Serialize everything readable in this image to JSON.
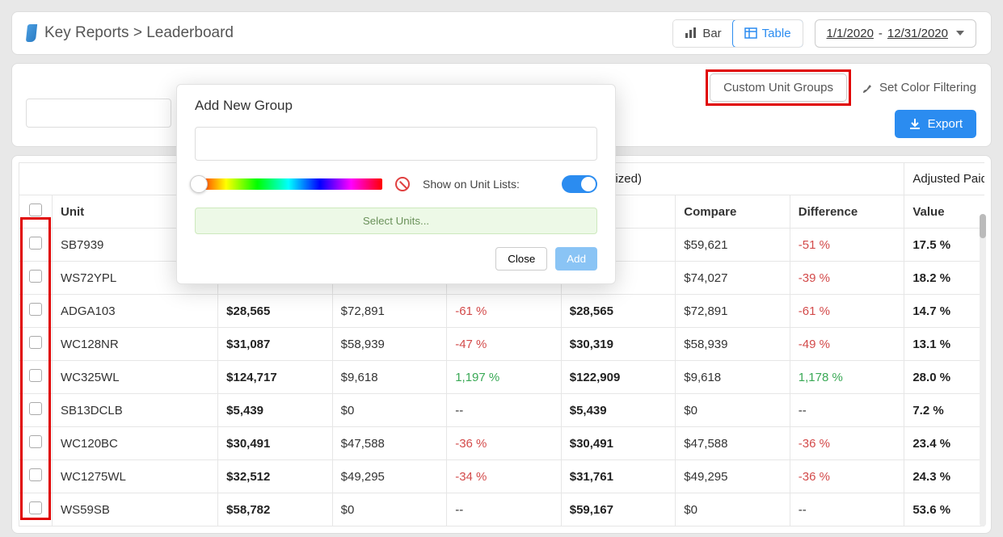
{
  "breadcrumb": {
    "section": "Key Reports",
    "page": "Leaderboard",
    "separator": ">"
  },
  "viewToggle": {
    "bar": "Bar",
    "table": "Table"
  },
  "dateRange": {
    "start": "1/1/2020",
    "sep": "-",
    "end": "12/31/2020"
  },
  "toolbar": {
    "custom_unit_groups": "Custom Unit Groups",
    "set_color_filtering": "Set Color Filtering",
    "export": "Export"
  },
  "modal": {
    "title": "Add New Group",
    "show_on_lists": "Show on Unit Lists:",
    "select_units": "Select Units...",
    "close": "Close",
    "add": "Add"
  },
  "tableHead": {
    "group1": "(Recognized)",
    "group2": "Adjusted Paid Occ",
    "unit": "Unit",
    "compare": "Compare",
    "difference": "Difference",
    "value": "Value"
  },
  "rows": [
    {
      "unit": "SB7939",
      "v1": "",
      "c1": "",
      "d1": "",
      "v2": "",
      "c2": "$59,621",
      "d2": "-51 %",
      "p": "17.5 %"
    },
    {
      "unit": "WS72YPL",
      "v1": "",
      "c1": "",
      "d1": "",
      "v2": "",
      "c2": "$74,027",
      "d2": "-39 %",
      "p": "18.2 %"
    },
    {
      "unit": "ADGA103",
      "v1": "$28,565",
      "c1": "$72,891",
      "d1": "-61 %",
      "v2": "$28,565",
      "c2": "$72,891",
      "d2": "-61 %",
      "p": "14.7 %"
    },
    {
      "unit": "WC128NR",
      "v1": "$31,087",
      "c1": "$58,939",
      "d1": "-47 %",
      "v2": "$30,319",
      "c2": "$58,939",
      "d2": "-49 %",
      "p": "13.1 %"
    },
    {
      "unit": "WC325WL",
      "v1": "$124,717",
      "c1": "$9,618",
      "d1": "1,197 %",
      "v2": "$122,909",
      "c2": "$9,618",
      "d2": "1,178 %",
      "p": "28.0 %"
    },
    {
      "unit": "SB13DCLB",
      "v1": "$5,439",
      "c1": "$0",
      "d1": "--",
      "v2": "$5,439",
      "c2": "$0",
      "d2": "--",
      "p": "7.2 %"
    },
    {
      "unit": "WC120BC",
      "v1": "$30,491",
      "c1": "$47,588",
      "d1": "-36 %",
      "v2": "$30,491",
      "c2": "$47,588",
      "d2": "-36 %",
      "p": "23.4 %"
    },
    {
      "unit": "WC1275WL",
      "v1": "$32,512",
      "c1": "$49,295",
      "d1": "-34 %",
      "v2": "$31,761",
      "c2": "$49,295",
      "d2": "-36 %",
      "p": "24.3 %"
    },
    {
      "unit": "WS59SB",
      "v1": "$58,782",
      "c1": "$0",
      "d1": "--",
      "v2": "$59,167",
      "c2": "$0",
      "d2": "--",
      "p": "53.6 %"
    }
  ]
}
